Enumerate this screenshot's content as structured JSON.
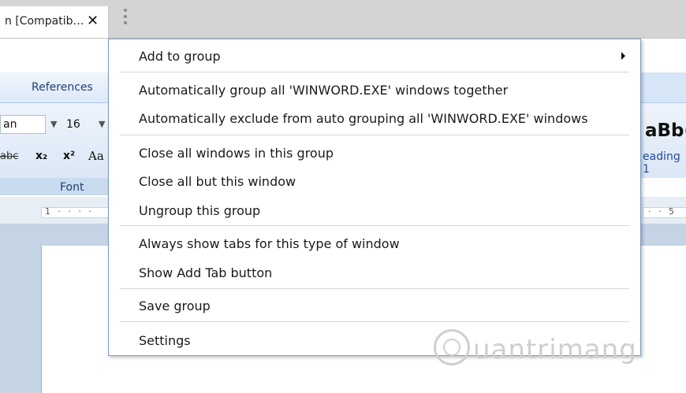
{
  "tab": {
    "title": "n [Compatib…",
    "close_glyph": "✕"
  },
  "word": {
    "ribbon_tab": "References",
    "font_name": "an",
    "font_size": "16",
    "dropdown_glyph": "▼",
    "strike_text": "abc",
    "subscript_text": "x₂",
    "superscript_text": "x²",
    "change_case_text": "Aa",
    "font_group_label": "Font",
    "style_preview": "aBb(",
    "style_name": "eading 1",
    "ruler_left": "1 · · · ·",
    "ruler_right": "· · 5"
  },
  "menu": {
    "items": [
      {
        "label": "Add to group",
        "submenu": true
      },
      {
        "label": "Automatically group all 'WINWORD.EXE' windows together"
      },
      {
        "label": "Automatically exclude from auto grouping all 'WINWORD.EXE' windows"
      },
      {
        "label": "Close all windows in this group"
      },
      {
        "label": "Close all but this window"
      },
      {
        "label": "Ungroup this group"
      },
      {
        "label": "Always show tabs for this type of window"
      },
      {
        "label": "Show Add Tab button"
      },
      {
        "label": "Save group"
      },
      {
        "label": "Settings"
      }
    ]
  },
  "watermark": {
    "text": "uantrimang"
  }
}
